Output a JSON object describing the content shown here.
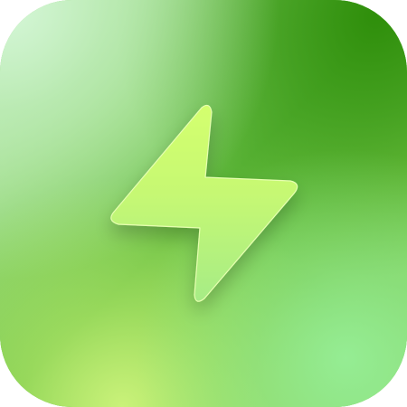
{
  "app_icon": {
    "name": "lightning-app-icon",
    "colors": {
      "top_left": "#d4f6d6",
      "top_right": "#2c8c08",
      "center": "#63bb3f",
      "bottom_left": "#ceF47c",
      "bottom_right": "#96ee96",
      "bolt_top": "#d2ff70",
      "bolt_bottom": "#a9ee84"
    }
  },
  "glyph": {
    "icon": "lightning-bolt-icon"
  }
}
